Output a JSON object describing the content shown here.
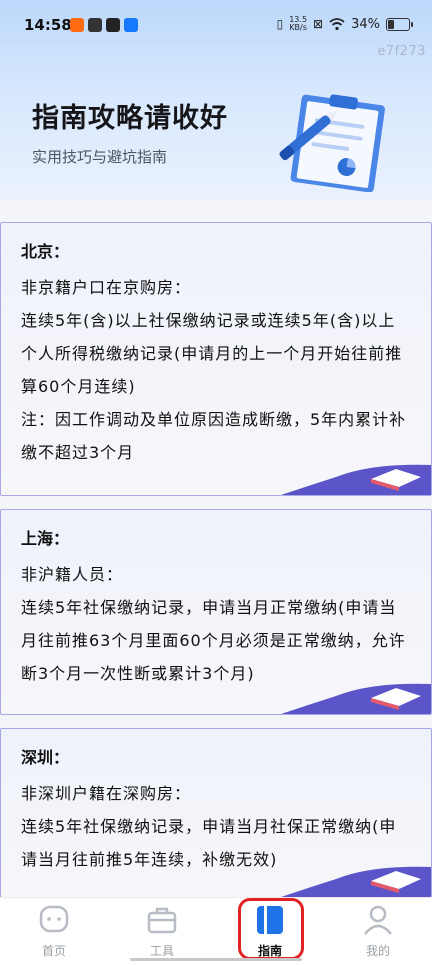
{
  "status_bar": {
    "time": "14:58",
    "net_speed_value": "13.5",
    "net_speed_unit": "KB/s",
    "battery": "34%",
    "battery_level": 0.34
  },
  "corner_code": "e7f273",
  "hero": {
    "title": "指南攻略请收好",
    "subtitle": "实用技巧与避坑指南"
  },
  "cards": [
    {
      "city": "北京：",
      "lines": [
        "非京籍户口在京购房：",
        "连续5年(含)以上社保缴纳记录或连续5年(含)以上个人所得税缴纳记录(申请月的上一个月开始往前推算60个月连续)",
        "注：因工作调动及单位原因造成断缴，5年内累计补缴不超过3个月"
      ]
    },
    {
      "city": "上海：",
      "lines": [
        "非沪籍人员：",
        "连续5年社保缴纳记录，申请当月正常缴纳(申请当月往前推63个月里面60个月必须是正常缴纳，允许断3个月一次性断或累计3个月)"
      ]
    },
    {
      "city": "深圳：",
      "lines": [
        "非深圳户籍在深购房：",
        "连续5年社保缴纳记录，申请当月社保正常缴纳(申请当月往前推5年连续，补缴无效)"
      ]
    }
  ],
  "tabbar": {
    "tabs": [
      {
        "label": "首页",
        "icon": "home-icon"
      },
      {
        "label": "工具",
        "icon": "toolbox-icon"
      },
      {
        "label": "指南",
        "icon": "guide-icon",
        "active": true
      },
      {
        "label": "我的",
        "icon": "user-icon"
      }
    ]
  },
  "colors": {
    "accent": "#1e73e8",
    "highlight": "#e02222",
    "card_border": "#a9a8e6",
    "wave": "#5b55c9"
  }
}
